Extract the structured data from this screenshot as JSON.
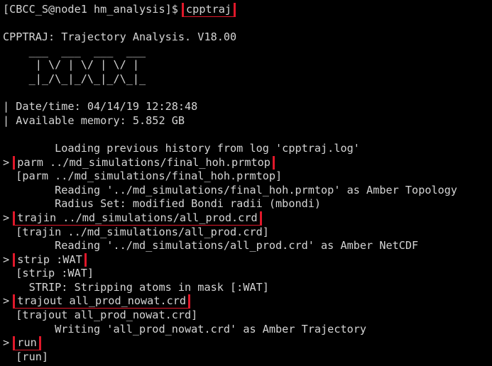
{
  "terminal": {
    "colors": {
      "background": "#000000",
      "text": "#d4d4d4",
      "highlight_box": "#e0182a"
    },
    "prompt_line": {
      "prompt": "[CBCC_S@node1 hm_analysis]$ ",
      "command": "cpptraj"
    },
    "blank_1": "",
    "title": "CPPTRAJ: Trajectory Analysis. V18.00",
    "logo": [
      "    ___  ___  ___  ___",
      "     | \\/ | \\/ | \\/ |",
      "    _|_/\\_|_/\\_|_/\\_|_"
    ],
    "blank_2": "",
    "info": [
      "| Date/time: 04/14/19 12:28:48",
      "| Available memory: 5.852 GB"
    ],
    "blank_3": "",
    "history_msg": "        Loading previous history from log 'cpptraj.log'",
    "commands": {
      "parm": {
        "input_prefix": "> ",
        "input": "parm ../md_simulations/final_hoh.prmtop",
        "echo": "  [parm ../md_simulations/final_hoh.prmtop]",
        "output": [
          "        Reading '../md_simulations/final_hoh.prmtop' as Amber Topology",
          "        Radius Set: modified Bondi radii (mbondi)"
        ]
      },
      "trajin": {
        "input_prefix": "> ",
        "input": "trajin ../md_simulations/all_prod.crd",
        "echo": "  [trajin ../md_simulations/all_prod.crd]",
        "output": [
          "        Reading '../md_simulations/all_prod.crd' as Amber NetCDF"
        ]
      },
      "strip": {
        "input_prefix": "> ",
        "input": "strip :WAT",
        "echo": "  [strip :WAT]",
        "output": [
          "    STRIP: Stripping atoms in mask [:WAT]"
        ]
      },
      "trajout": {
        "input_prefix": "> ",
        "input": "trajout all_prod_nowat.crd",
        "echo": "  [trajout all_prod_nowat.crd]",
        "output": [
          "        Writing 'all_prod_nowat.crd' as Amber Trajectory"
        ]
      },
      "run": {
        "input_prefix": "> ",
        "input": "run",
        "echo": "  [run]"
      }
    }
  }
}
